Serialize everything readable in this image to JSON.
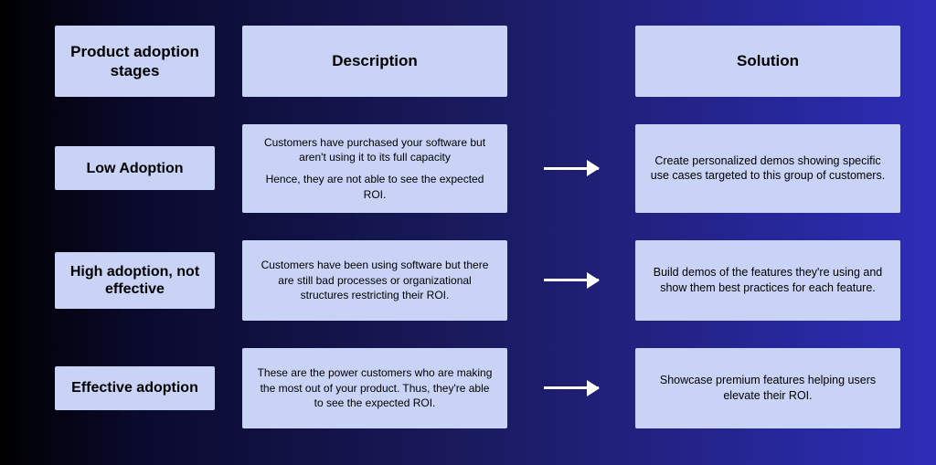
{
  "headers": {
    "stages": "Product adoption stages",
    "description": "Description",
    "solution": "Solution"
  },
  "rows": [
    {
      "stage": "Low Adoption",
      "description": [
        "Customers have purchased your software but aren't using it to its full capacity",
        "Hence, they are not able to see the expected ROI."
      ],
      "solution": "Create personalized demos showing specific use cases targeted to this group of customers."
    },
    {
      "stage": "High adoption, not effective",
      "description": [
        "Customers have been using software but there are still bad processes or organizational structures restricting their ROI."
      ],
      "solution": "Build demos of the features they're using and show them best practices for each feature."
    },
    {
      "stage": "Effective adoption",
      "description": [
        "These are the power customers who are making the most out of your product. Thus, they're able to see the expected ROI."
      ],
      "solution": "Showcase premium features helping users elevate their ROI."
    }
  ]
}
